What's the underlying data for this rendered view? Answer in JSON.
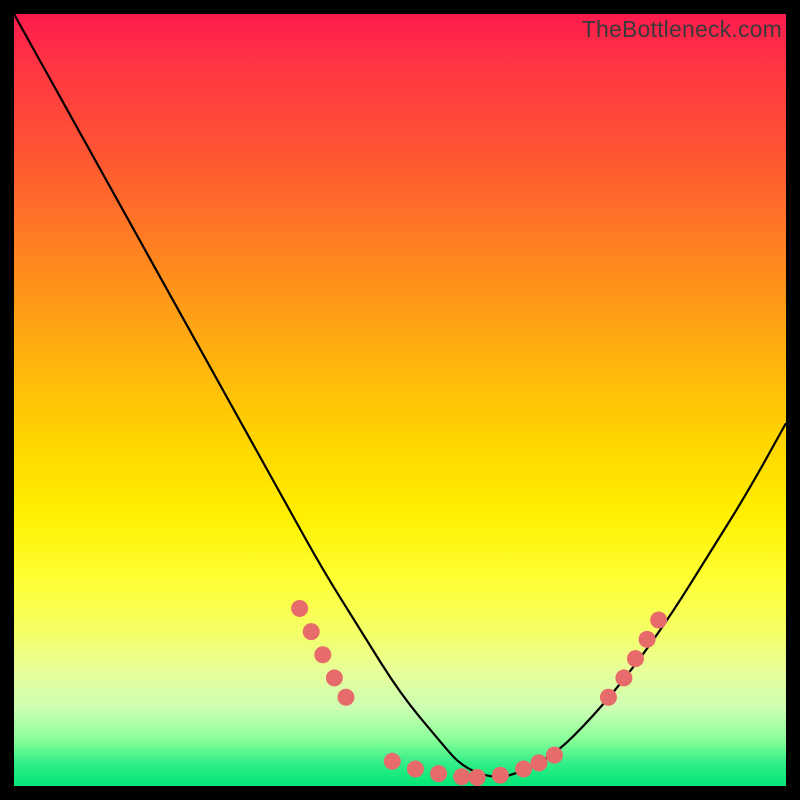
{
  "watermark": "TheBottleneck.com",
  "chart_data": {
    "type": "line",
    "title": "",
    "xlabel": "",
    "ylabel": "",
    "xlim": [
      0,
      100
    ],
    "ylim": [
      0,
      100
    ],
    "series": [
      {
        "name": "bottleneck-curve",
        "x": [
          0,
          5,
          10,
          15,
          20,
          25,
          30,
          35,
          40,
          45,
          50,
          55,
          58,
          62,
          65,
          70,
          75,
          80,
          85,
          90,
          95,
          100
        ],
        "y": [
          100,
          91,
          82,
          73,
          64,
          55,
          46,
          37,
          28,
          20,
          12,
          6,
          2.5,
          1,
          1.5,
          4,
          9,
          15,
          22,
          30,
          38,
          47
        ]
      }
    ],
    "markers": {
      "name": "highlight-dots",
      "color": "#e86b6b",
      "points": [
        {
          "x": 37,
          "y": 23
        },
        {
          "x": 38.5,
          "y": 20
        },
        {
          "x": 40,
          "y": 17
        },
        {
          "x": 41.5,
          "y": 14
        },
        {
          "x": 43,
          "y": 11.5
        },
        {
          "x": 49,
          "y": 3.2
        },
        {
          "x": 52,
          "y": 2.2
        },
        {
          "x": 55,
          "y": 1.6
        },
        {
          "x": 58,
          "y": 1.2
        },
        {
          "x": 60,
          "y": 1.1
        },
        {
          "x": 63,
          "y": 1.4
        },
        {
          "x": 66,
          "y": 2.2
        },
        {
          "x": 68,
          "y": 3.0
        },
        {
          "x": 70,
          "y": 4.0
        },
        {
          "x": 77,
          "y": 11.5
        },
        {
          "x": 79,
          "y": 14
        },
        {
          "x": 80.5,
          "y": 16.5
        },
        {
          "x": 82,
          "y": 19
        },
        {
          "x": 83.5,
          "y": 21.5
        }
      ]
    },
    "gradient_stops": [
      {
        "pos": 0,
        "color": "#ff1a4d"
      },
      {
        "pos": 50,
        "color": "#ffd400"
      },
      {
        "pos": 80,
        "color": "#ffff66"
      },
      {
        "pos": 100,
        "color": "#00e676"
      }
    ]
  }
}
